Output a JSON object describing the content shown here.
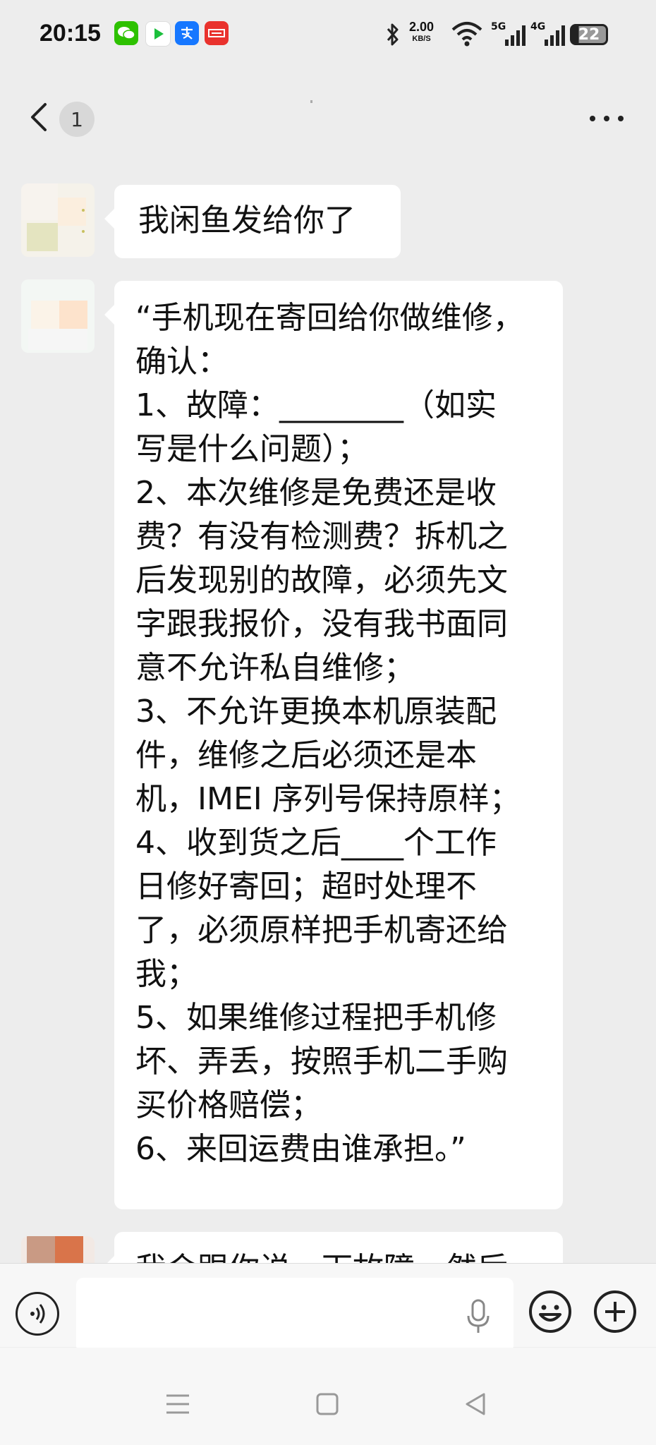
{
  "status_bar": {
    "time": "20:15",
    "app_icons": [
      {
        "name": "wechat-icon",
        "color": "#2dc100",
        "glyph": "●"
      },
      {
        "name": "iqiyi-icon",
        "color": "#1bbf3c",
        "glyph": "▶"
      },
      {
        "name": "alipay-icon",
        "color": "#1677ff",
        "glyph": "支"
      },
      {
        "name": "toutiao-icon",
        "color": "#e9322d",
        "glyph": "头条"
      }
    ],
    "net_speed": "2.00",
    "net_unit": "KB/S",
    "signal_labels": [
      "5G",
      "4G"
    ],
    "battery": "22"
  },
  "nav": {
    "unread_count": "1"
  },
  "messages": [
    {
      "lines": [
        "我闲鱼发给你了"
      ]
    },
    {
      "lines": [
        "“手机现在寄回给你做维修，",
        "确认：",
        "1、故障：________（如实",
        "写是什么问题）；",
        "2、本次维修是免费还是收",
        "费？有没有检测费？拆机之",
        "后发现别的故障，必须先文",
        "字跟我报价，没有我书面同",
        "意不允许私自维修；",
        "3、不允许更换本机原装配",
        "件，维修之后必须还是本",
        "机，IMEI 序列号保持原样；",
        "4、收到货之后____个工作",
        "日修好寄回；超时处理不",
        "了，必须原样把手机寄还给",
        "我；",
        "5、如果维修过程把手机修",
        "坏、弄丢，按照手机二手购",
        "买价格赔偿；",
        "6、来回运费由谁承担。”"
      ]
    },
    {
      "lines": [
        "我会跟你说一下故障，然后"
      ]
    }
  ],
  "input": {
    "value": ""
  },
  "colors": {
    "background": "#ededed",
    "bubble": "#ffffff",
    "bar": "#f7f7f7"
  }
}
